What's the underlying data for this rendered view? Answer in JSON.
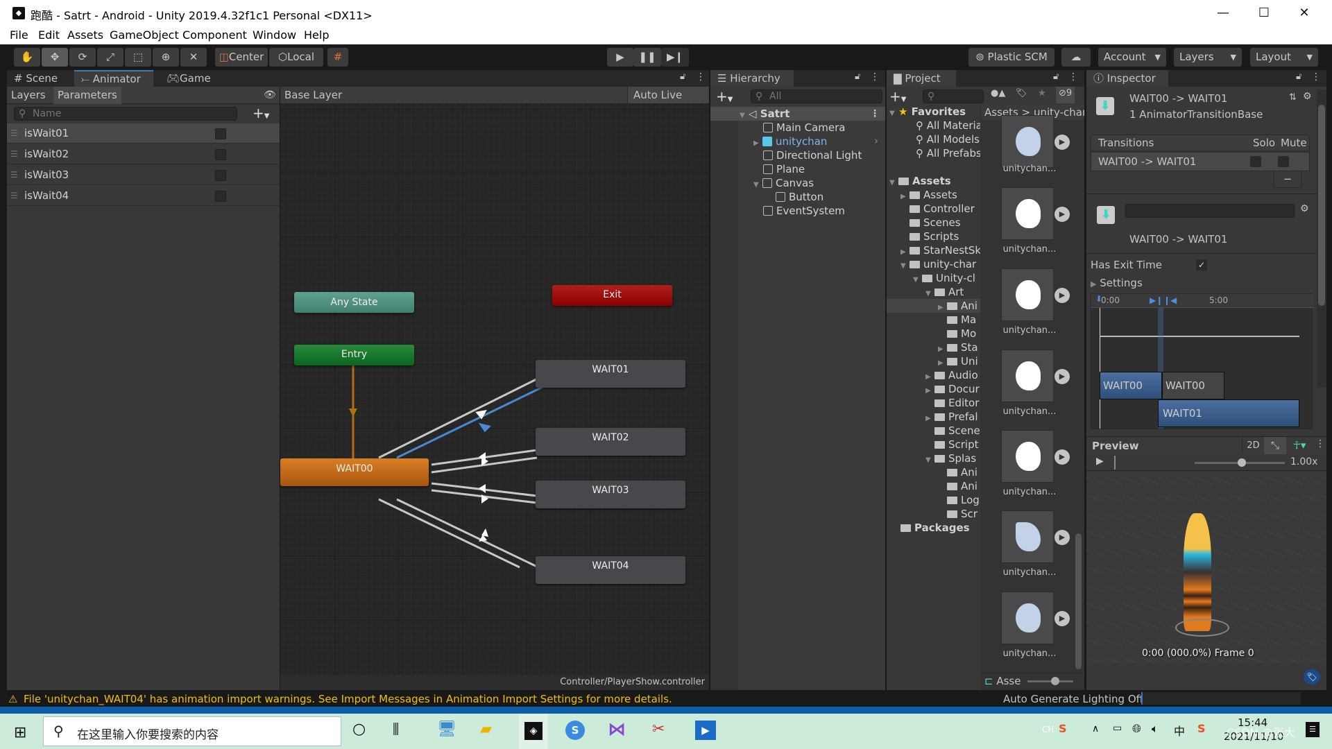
{
  "window": {
    "title": "跑酷 - Satrt - Android - Unity 2019.4.32f1c1 Personal <DX11>",
    "minimize_glyph": "—",
    "maximize_glyph": "☐",
    "close_glyph": "✕"
  },
  "menu": [
    "File",
    "Edit",
    "Assets",
    "GameObject",
    "Component",
    "Window",
    "Help"
  ],
  "toolbar": {
    "tools": [
      "hand-tool",
      "move-tool",
      "rotate-tool",
      "scale-tool",
      "rect-tool",
      "transform-tool",
      "custom-tool"
    ],
    "pivot_label": "Center",
    "space_label": "Local",
    "play_glyph": "▶",
    "pause_glyph": "❚❚",
    "step_glyph": "▶❙",
    "plastic_label": "Plastic SCM",
    "account_label": "Account",
    "layers_label": "Layers",
    "layout_label": "Layout"
  },
  "tabs": {
    "scene": "Scene",
    "animator": "Animator",
    "game": "Game",
    "hierarchy": "Hierarchy",
    "project": "Project",
    "inspector": "Inspector"
  },
  "animator": {
    "subtabs": [
      "Layers",
      "Parameters"
    ],
    "search_placeholder": "Name",
    "parameters": [
      {
        "name": "isWait01",
        "value": false
      },
      {
        "name": "isWait02",
        "value": false
      },
      {
        "name": "isWait03",
        "value": false
      },
      {
        "name": "isWait04",
        "value": false
      }
    ],
    "breadcrumb": "Base Layer",
    "auto_live_link": "Auto Live Link",
    "nodes": {
      "any_state": "Any State",
      "exit": "Exit",
      "entry": "Entry",
      "wait00": "WAIT00",
      "wait01": "WAIT01",
      "wait02": "WAIT02",
      "wait03": "WAIT03",
      "wait04": "WAIT04"
    },
    "footer_path": "Controller/PlayerShow.controller"
  },
  "hierarchy": {
    "search_placeholder": "All",
    "scene": "Satrt",
    "items": [
      {
        "label": "Main Camera",
        "depth": 1
      },
      {
        "label": "unitychan",
        "depth": 1,
        "prefab": true
      },
      {
        "label": "Directional Light",
        "depth": 1
      },
      {
        "label": "Plane",
        "depth": 1
      },
      {
        "label": "Canvas",
        "depth": 1
      },
      {
        "label": "Button",
        "depth": 2
      },
      {
        "label": "EventSystem",
        "depth": 1
      }
    ]
  },
  "project": {
    "hidden_count": "9",
    "breadcrumb": [
      "Assets",
      "unity-chan"
    ],
    "favorites_label": "Favorites",
    "favorites": [
      "All Materia",
      "All Models",
      "All Prefabs"
    ],
    "assets_label": "Assets",
    "tree": [
      {
        "label": "Assets",
        "depth": 1
      },
      {
        "label": "Controller",
        "depth": 1
      },
      {
        "label": "Scenes",
        "depth": 1
      },
      {
        "label": "Scripts",
        "depth": 1
      },
      {
        "label": "StarNestSk",
        "depth": 1
      },
      {
        "label": "unity-char",
        "depth": 1
      },
      {
        "label": "Unity-cl",
        "depth": 2
      },
      {
        "label": "Art",
        "depth": 3
      },
      {
        "label": "Ani",
        "depth": 4
      },
      {
        "label": "Ma",
        "depth": 4
      },
      {
        "label": "Mo",
        "depth": 4
      },
      {
        "label": "Sta",
        "depth": 4
      },
      {
        "label": "Uni",
        "depth": 4
      },
      {
        "label": "Audio",
        "depth": 3
      },
      {
        "label": "Docur",
        "depth": 3
      },
      {
        "label": "Editor",
        "depth": 3
      },
      {
        "label": "Prefal",
        "depth": 3
      },
      {
        "label": "Scene",
        "depth": 3
      },
      {
        "label": "Script",
        "depth": 3
      },
      {
        "label": "Splas",
        "depth": 3
      },
      {
        "label": "Ani",
        "depth": 4
      },
      {
        "label": "Ani",
        "depth": 4
      },
      {
        "label": "Log",
        "depth": 4
      },
      {
        "label": "Scr",
        "depth": 4
      }
    ],
    "packages_label": "Packages",
    "thumbnails": [
      "unitychan...",
      "unitychan...",
      "unitychan...",
      "unitychan...",
      "unitychan...",
      "unitychan...",
      "unitychan..."
    ],
    "footer_label": "Asse"
  },
  "inspector": {
    "title": "WAIT00 -> WAIT01",
    "subtitle": "1 AnimatorTransitionBase",
    "transitions_header": "Transitions",
    "solo_label": "Solo",
    "mute_label": "Mute",
    "transition_row": "WAIT00 -> WAIT01",
    "transition_name": "WAIT00 -> WAIT01",
    "has_exit_time_label": "Has Exit Time",
    "has_exit_time": true,
    "settings_label": "Settings",
    "timeline": {
      "tick_0": "0:00",
      "tick_5": "5:00",
      "clip_a": "WAIT00",
      "clip_a2": "WAIT00",
      "clip_b": "WAIT01"
    },
    "preview_label": "Preview",
    "preview_2d": "2D",
    "preview_speed": "1.00x",
    "preview_status": "0:00 (000.0%) Frame 0"
  },
  "status": {
    "warning": "File 'unitychan_WAIT04' has animation import warnings. See Import Messages in Animation Import Settings for more details.",
    "lighting": "Auto Generate Lighting Off"
  },
  "taskbar": {
    "search_placeholder": "在这里输入你要搜索的内容",
    "ime": "CH",
    "ime_mode": "中",
    "time": "15:44",
    "date": "2021/11/10",
    "watermark": "CSDN @张大"
  }
}
